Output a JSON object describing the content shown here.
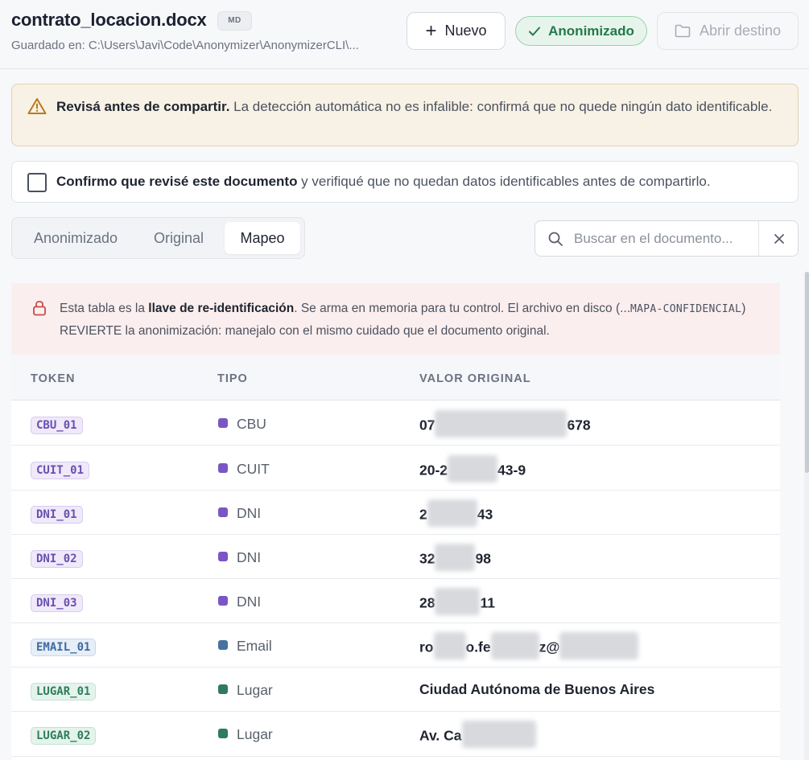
{
  "header": {
    "title": "contrato_locacion.docx",
    "format_badge": "MD",
    "saved_path": "Guardado en: C:\\Users\\Javi\\Code\\Anonymizer\\AnonymizerCLI\\...",
    "new_button": "Nuevo",
    "status": "Anonimizado",
    "open_button": "Abrir destino"
  },
  "warning": {
    "bold": "Revisá antes de compartir.",
    "text": " La detección automática no es infalible: confirmá que no quede ningún dato identificable."
  },
  "confirm": {
    "bold": "Confirmo que revisé este documento",
    "text": " y verifiqué que no quedan datos identificables antes de compartirlo.",
    "checked": false
  },
  "tabs": [
    {
      "label": "Anonimizado",
      "active": false
    },
    {
      "label": "Original",
      "active": false
    },
    {
      "label": "Mapeo",
      "active": true
    }
  ],
  "search": {
    "placeholder": "Buscar en el documento...",
    "value": ""
  },
  "notice": {
    "pre": "Esta tabla es la ",
    "bold": "llave de re-identificación",
    "mid": ". Se arma en memoria para tu control. El archivo en disco (...",
    "code": "MAPA-CONFIDENCIAL",
    "post": ") REVIERTE la anonimización: manejalo con el mismo cuidado que el documento original."
  },
  "table": {
    "columns": [
      "TOKEN",
      "TIPO",
      "VALOR ORIGINAL"
    ],
    "rows": [
      {
        "token": "CBU_01",
        "tipo": "CBU",
        "valor_parts": [
          "07",
          "678"
        ]
      },
      {
        "token": "CUIT_01",
        "tipo": "CUIT",
        "valor_parts": [
          "20-2",
          "43-9"
        ]
      },
      {
        "token": "DNI_01",
        "tipo": "DNI",
        "valor_parts": [
          "2",
          "43"
        ]
      },
      {
        "token": "DNI_02",
        "tipo": "DNI",
        "valor_parts": [
          "32",
          "98"
        ]
      },
      {
        "token": "DNI_03",
        "tipo": "DNI",
        "valor_parts": [
          "28",
          "11"
        ]
      },
      {
        "token": "EMAIL_01",
        "tipo": "Email",
        "valor_parts": [
          "ro",
          "o.fe",
          "z@"
        ]
      },
      {
        "token": "LUGAR_01",
        "tipo": "Lugar",
        "valor_parts": [
          "Ciudad Autónoma de Buenos Aires"
        ]
      },
      {
        "token": "LUGAR_02",
        "tipo": "Lugar",
        "valor_parts": [
          "Av. Ca"
        ]
      }
    ]
  },
  "colors": {
    "status_green": "#237a48",
    "status_bg": "#e7f4ec",
    "warning_bg": "#f8f1e5",
    "warning_icon": "#b7791f",
    "notice_bg": "#fbeeee",
    "lock_icon": "#c94a4a",
    "numeric_token_text": "#6a4fb0",
    "numeric_token_bg": "#efe9fa",
    "numeric_dot": "#7b55c4",
    "email_token_text": "#3d6aa0",
    "email_token_bg": "#e6eef8",
    "email_dot": "#46729e",
    "place_token_text": "#2e7d5b",
    "place_token_bg": "#e4f3ec",
    "place_dot": "#2f7a62"
  }
}
